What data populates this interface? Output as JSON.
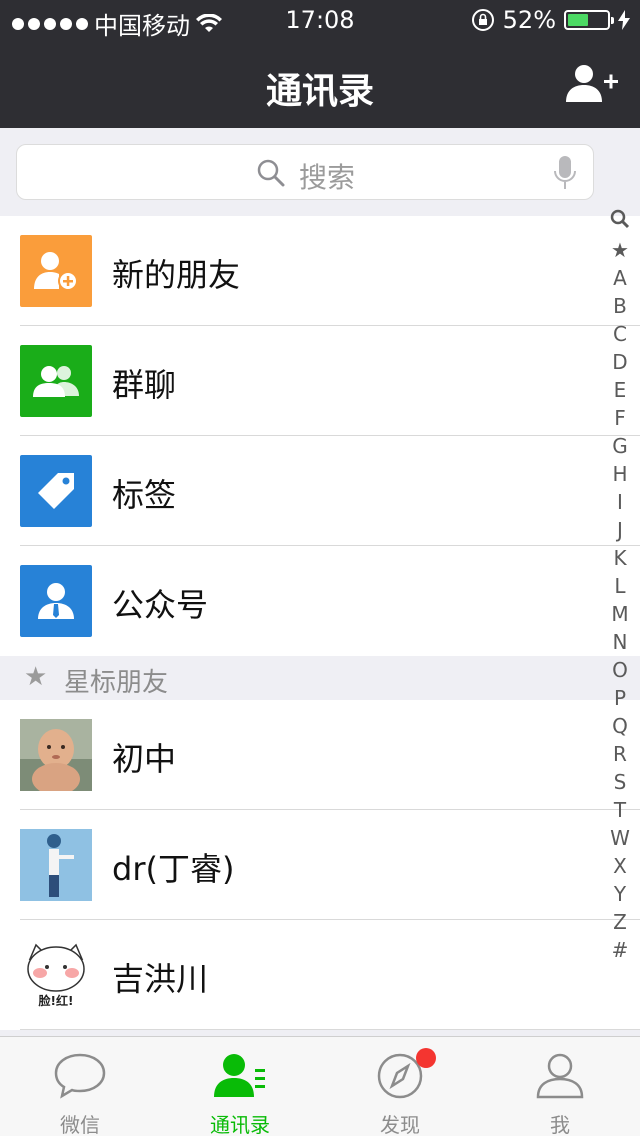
{
  "status": {
    "carrier": "中国移动",
    "time": "17:08",
    "battery": "52%",
    "battery_level": 0.52
  },
  "nav": {
    "title": "通讯录",
    "add_icon": "add-contact-icon"
  },
  "search": {
    "placeholder": "搜索"
  },
  "menu": [
    {
      "label": "新的朋友",
      "icon": "new-friend-icon",
      "color": "#fa9d3b"
    },
    {
      "label": "群聊",
      "icon": "group-chat-icon",
      "color": "#1aad19"
    },
    {
      "label": "标签",
      "icon": "tag-icon",
      "color": "#2782d7"
    },
    {
      "label": "公众号",
      "icon": "official-account-icon",
      "color": "#2782d7"
    }
  ],
  "starred": {
    "header": "星标朋友",
    "contacts": [
      "初中",
      "dr(丁睿)",
      "吉洪川"
    ]
  },
  "index": [
    "★",
    "A",
    "B",
    "C",
    "D",
    "E",
    "F",
    "G",
    "H",
    "I",
    "J",
    "K",
    "L",
    "M",
    "N",
    "O",
    "P",
    "Q",
    "R",
    "S",
    "T",
    "W",
    "X",
    "Y",
    "Z",
    "#"
  ],
  "tabs": [
    {
      "label": "微信",
      "icon": "chat-bubble-icon"
    },
    {
      "label": "通讯录",
      "icon": "contacts-icon"
    },
    {
      "label": "发现",
      "icon": "compass-icon"
    },
    {
      "label": "我",
      "icon": "profile-icon"
    }
  ],
  "colors": {
    "accent": "#09bb07",
    "navbar": "#2e2e33",
    "badge": "#f43530"
  },
  "avatar_text": "脸!红!"
}
